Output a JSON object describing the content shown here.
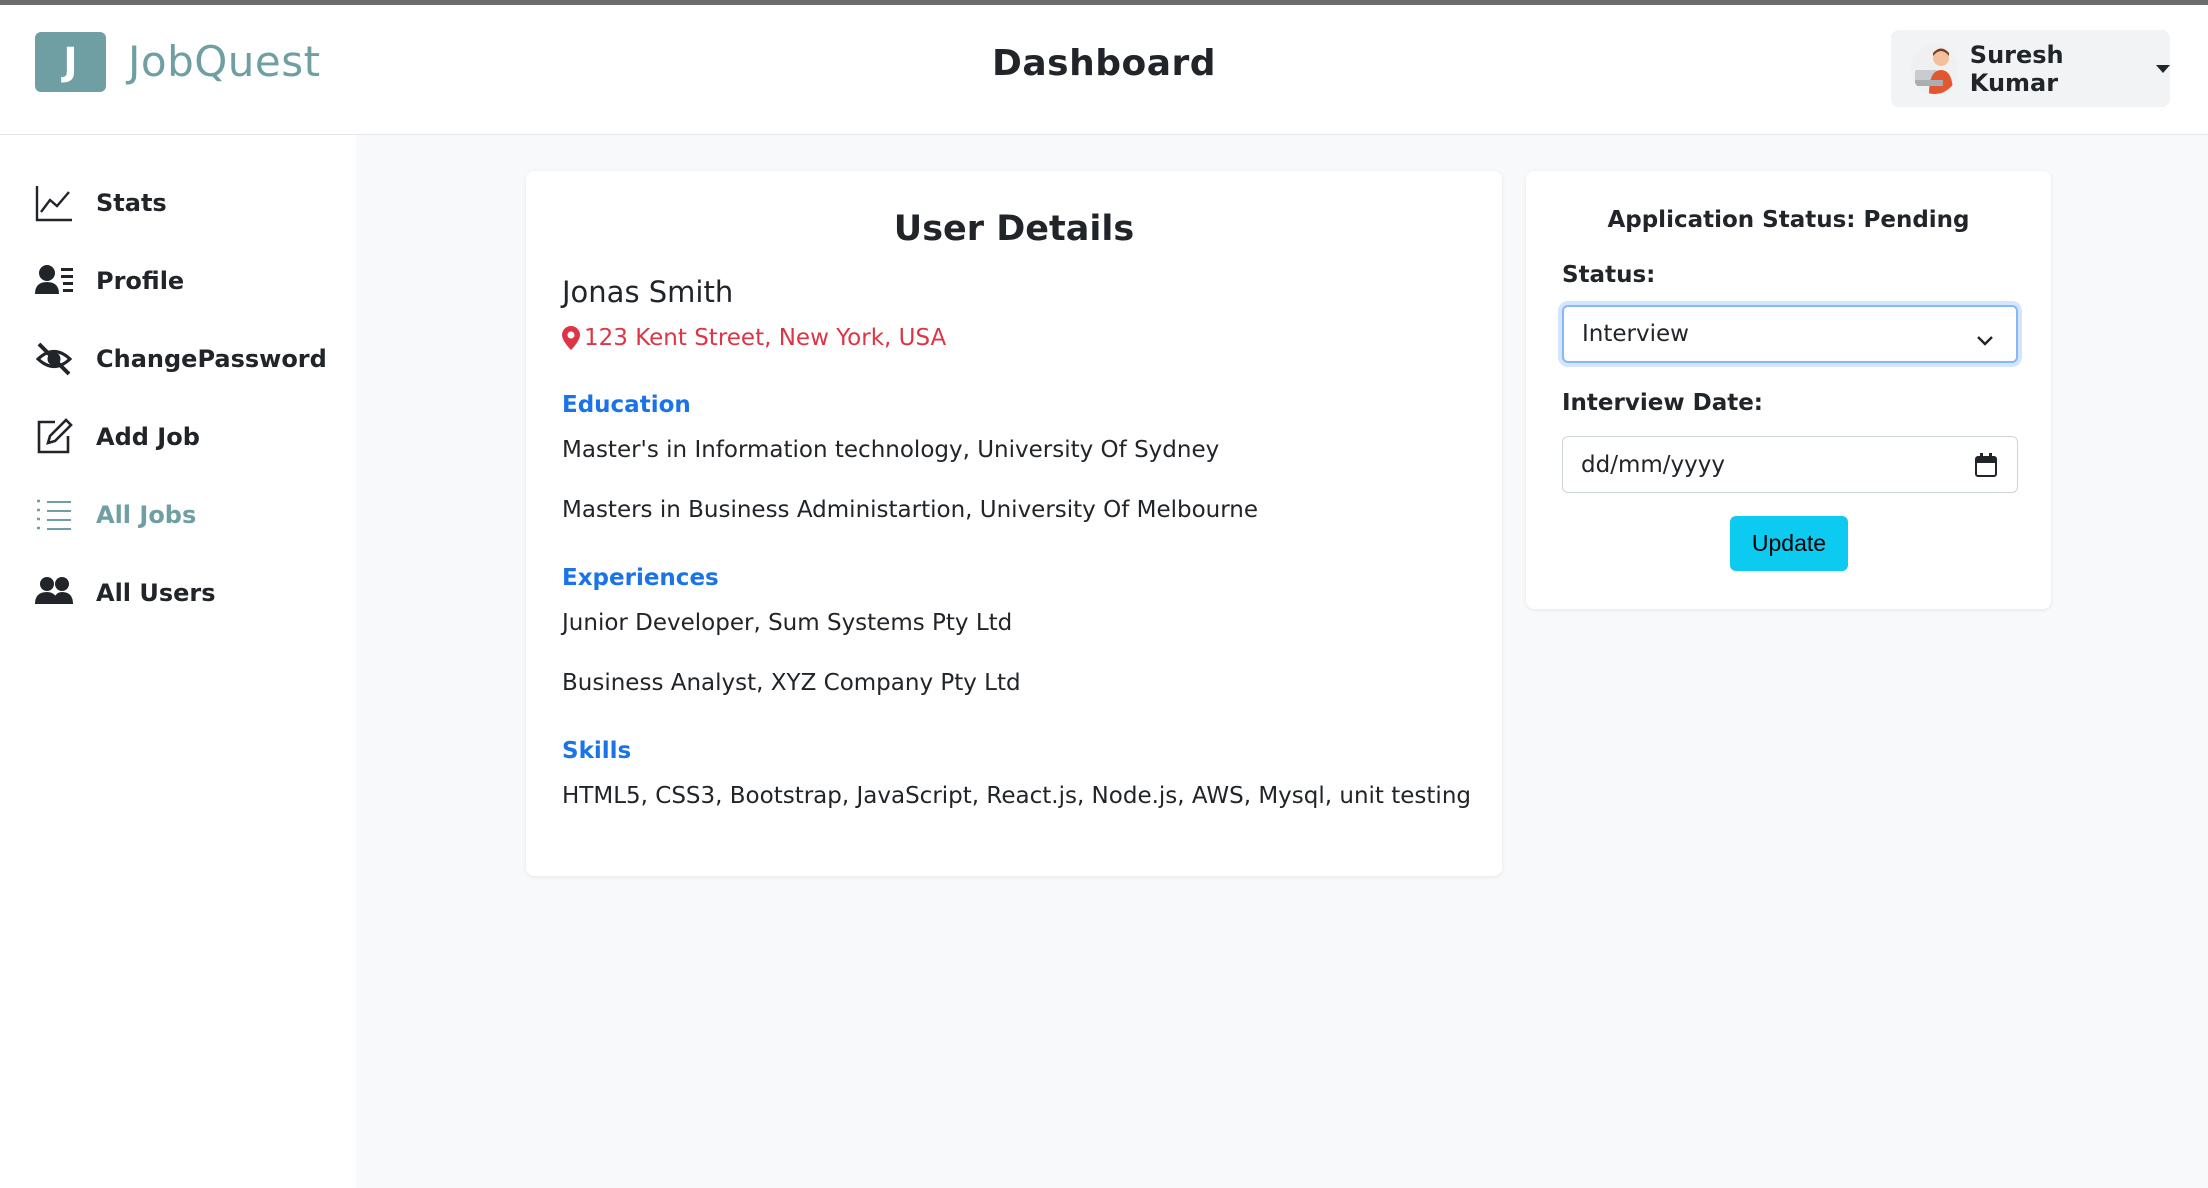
{
  "brand": {
    "logo_letter": "J",
    "name": "JobQuest",
    "color": "#6f9fa3"
  },
  "header": {
    "title": "Dashboard"
  },
  "user_menu": {
    "name": "Suresh Kumar"
  },
  "sidebar": {
    "items": [
      {
        "label": "Stats",
        "icon": "chart-line-icon"
      },
      {
        "label": "Profile",
        "icon": "profile-card-icon"
      },
      {
        "label": "ChangePassword",
        "icon": "eye-slash-icon"
      },
      {
        "label": "Add Job",
        "icon": "edit-icon"
      },
      {
        "label": "All Jobs",
        "icon": "list-icon",
        "active": true
      },
      {
        "label": "All Users",
        "icon": "users-icon"
      }
    ]
  },
  "details": {
    "title": "User Details",
    "name": "Jonas Smith",
    "address": "123 Kent Street, New York, USA",
    "education_title": "Education",
    "education": [
      "Master's in Information technology, University Of Sydney",
      "Masters in Business Administartion, University Of Melbourne"
    ],
    "experiences_title": "Experiences",
    "experiences": [
      "Junior Developer, Sum Systems Pty Ltd",
      "Business Analyst, XYZ Company Pty Ltd"
    ],
    "skills_title": "Skills",
    "skills": "HTML5, CSS3, Bootstrap, JavaScript, React.js, Node.js, AWS, Mysql, unit testing"
  },
  "status_panel": {
    "heading": "Application Status: Pending",
    "status_label": "Status:",
    "status_value": "Interview",
    "date_label": "Interview Date:",
    "date_placeholder": "dd/mm/yyyy",
    "update_label": "Update"
  },
  "colors": {
    "accent": "#6f9fa3",
    "link_blue": "#1a73e8",
    "address_red": "#dc3545",
    "button_cyan": "#0dcaf0"
  }
}
